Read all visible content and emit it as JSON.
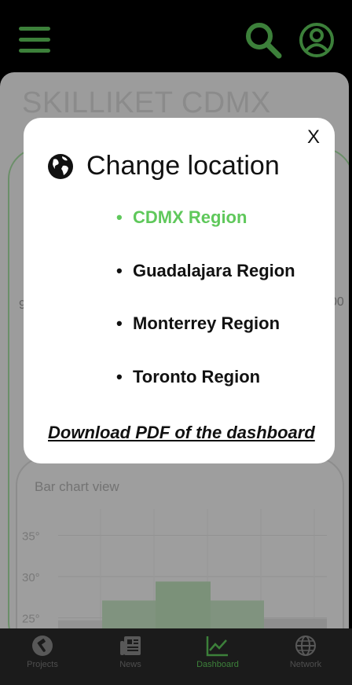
{
  "header": {
    "menu_icon": "hamburger-menu-icon",
    "search_icon": "search-icon",
    "profile_icon": "user-profile-icon",
    "accent_color": "#5fc85b"
  },
  "page": {
    "title": "SKILLIKET CDMX",
    "side_left": "9",
    "side_right": "00"
  },
  "bar_chart": {
    "title": "Bar chart view"
  },
  "chart_data": {
    "type": "bar",
    "title": "Bar chart view",
    "y_ticks": [
      "35°",
      "30°",
      "25°"
    ],
    "ylim": [
      20,
      37
    ],
    "values": [
      24.7,
      27.1,
      29.4,
      27.1,
      24.9
    ],
    "colors": [
      "#e6e6e6",
      "#c9e7c7",
      "#c0e3bd",
      "#c9e7c7",
      "#dedede"
    ],
    "grid": true
  },
  "modal": {
    "close_label": "X",
    "globe_icon": "globe-icon",
    "title": "Change location",
    "regions": [
      {
        "label": "CDMX Region",
        "selected": true
      },
      {
        "label": "Guadalajara Region",
        "selected": false
      },
      {
        "label": "Monterrey Region",
        "selected": false
      },
      {
        "label": "Toronto Region",
        "selected": false
      }
    ],
    "bullet": "•",
    "download_link": "Download PDF of the dashboard"
  },
  "bottom_nav": {
    "items": [
      {
        "label": "Projects",
        "icon": "hammer-icon",
        "active": false
      },
      {
        "label": "News",
        "icon": "newspaper-icon",
        "active": false
      },
      {
        "label": "Dashboard",
        "icon": "line-chart-icon",
        "active": true
      },
      {
        "label": "Network",
        "icon": "globe-network-icon",
        "active": false
      }
    ]
  }
}
